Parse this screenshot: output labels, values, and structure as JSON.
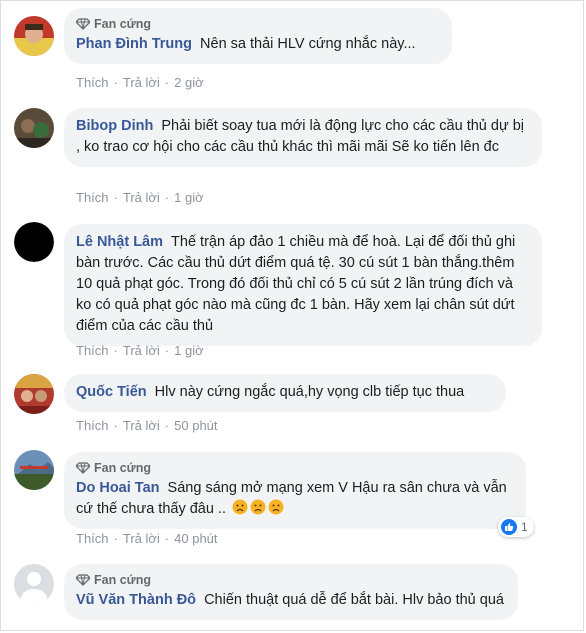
{
  "badge_label": "Fan cứng",
  "action_like": "Thích",
  "action_reply": "Trả lời",
  "comments": [
    {
      "badge": true,
      "author": "Phan Đình Trung",
      "text": "Nên sa thải HLV cứng nhắc này...",
      "time": "2 giờ"
    },
    {
      "badge": false,
      "author": "Bibop Dinh",
      "text": "Phải biết soay tua mới là động lực cho các cầu thủ dự bị , ko trao cơ hội cho các cầu thủ khác thì mãi mãi Sẽ ko tiến lên đc",
      "time": "1 giờ"
    },
    {
      "badge": false,
      "author": "Lê Nhật Lâm",
      "text": "Thế trận áp đảo 1 chiều mà để hoà. Lại để đối thủ ghi bàn trước. Các cầu thủ dứt điểm quá tệ. 30 cú sút 1 bàn thắng.thêm 10 quả phạt góc. Trong đó đối thủ chỉ có 5 cú sút 2 lần trúng đích và ko có quả phạt góc nào mà cũng đc 1 bàn. Hãy xem lại chân sút dứt điểm của các cầu thủ",
      "time": "1 giờ"
    },
    {
      "badge": false,
      "author": "Quốc Tiến",
      "text": "Hlv này cứng ngắc quá,hy vọng clb tiếp tục thua",
      "time": "50 phút"
    },
    {
      "badge": true,
      "author": "Do Hoai Tan",
      "text": "Sáng sáng mở mạng xem V Hậu ra sân chưa và vẫn cứ thế chưa thấy đâu ..",
      "emoji": [
        "sad-face-icon",
        "sad-face-icon",
        "sad-face-icon"
      ],
      "time": "40 phút",
      "reaction_count": "1"
    },
    {
      "badge": true,
      "author": "Vũ Văn Thành Đô",
      "text": "Chiến thuật quá dễ để bắt bài. Hlv bảo thủ quá",
      "time": ""
    }
  ],
  "colors": {
    "author": "#385898",
    "bubble": "#f2f3f5",
    "meta": "#8d949e",
    "like": "#1877f2",
    "emoji": "#f7b125"
  }
}
